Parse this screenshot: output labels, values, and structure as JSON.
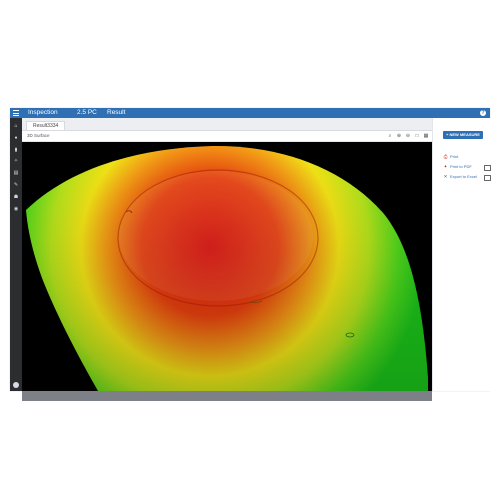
{
  "topbar": {
    "breadcrumbs": [
      "Inspection",
      "2.5 PC",
      "Result"
    ]
  },
  "sidebar": {
    "icons": [
      "home-icon",
      "globe-icon",
      "book-icon",
      "tools-icon",
      "layers-icon",
      "wrench-icon",
      "users-icon",
      "target-icon"
    ]
  },
  "main": {
    "tab_label": "Result3334",
    "view_label": "3D Surface",
    "tools": [
      "search-icon",
      "zoom-in-icon",
      "zoom-out-icon",
      "fit-view-icon",
      "grid-icon"
    ]
  },
  "right_panel": {
    "new_button": "+ NEW MEASURE",
    "actions": [
      {
        "label": "Print",
        "icon": "print-icon"
      },
      {
        "label": "Print to PDF",
        "icon": "pdf-icon"
      },
      {
        "label": "Export to Excel",
        "icon": "excel-icon"
      }
    ]
  },
  "colors": {
    "accent": "#2f6fb3",
    "sidebar": "#2b2d31",
    "surface_peak": "#e11a12",
    "surface_mid": "#f4e516",
    "surface_low": "#1fd21a"
  }
}
